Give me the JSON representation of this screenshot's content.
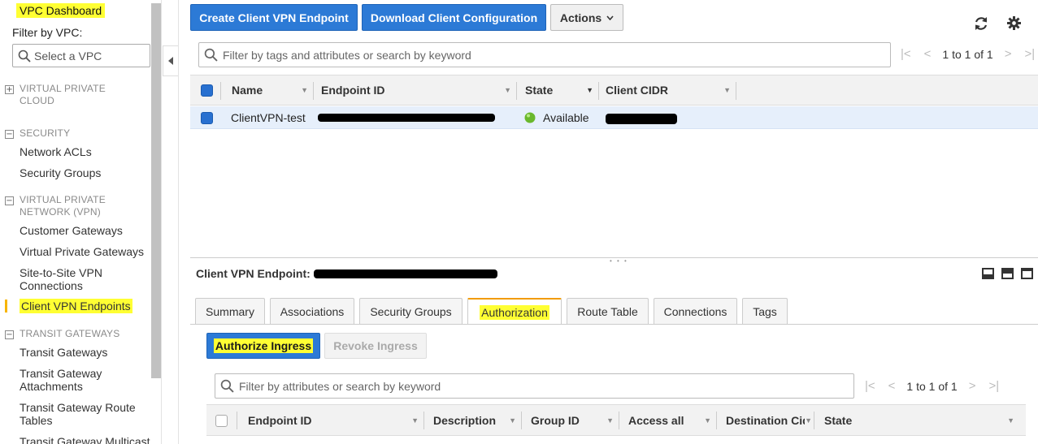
{
  "sidebar": {
    "dashboard": "VPC Dashboard",
    "filter_label": "Filter by VPC:",
    "vpc_placeholder": "Select a VPC",
    "groups": [
      {
        "toggle": "+",
        "title": "VIRTUAL PRIVATE CLOUD"
      },
      {
        "toggle": "−",
        "title": "SECURITY"
      },
      {
        "toggle": "−",
        "title": "VIRTUAL PRIVATE NETWORK (VPN)"
      },
      {
        "toggle": "−",
        "title": "TRANSIT GATEWAYS"
      }
    ],
    "items": {
      "network_acls": "Network ACLs",
      "security_groups": "Security Groups",
      "customer_gateways": "Customer Gateways",
      "virtual_private_gateways": "Virtual Private Gateways",
      "site_to_site_vpn": "Site-to-Site VPN Connections",
      "client_vpn_endpoints": "Client VPN Endpoints",
      "transit_gateways": "Transit Gateways",
      "tgw_attachments": "Transit Gateway Attachments",
      "tgw_route_tables": "Transit Gateway Route Tables",
      "tgw_multicast": "Transit Gateway Multicast"
    }
  },
  "toolbar": {
    "create_label": "Create Client VPN Endpoint",
    "download_label": "Download Client Configuration",
    "actions_label": "Actions"
  },
  "main_table": {
    "filter_placeholder": "Filter by tags and attributes or search by keyword",
    "pager_text": "1 to 1 of 1",
    "columns": [
      "Name",
      "Endpoint ID",
      "State",
      "Client CIDR"
    ],
    "rows": [
      {
        "name": "ClientVPN-test",
        "state": "Available"
      }
    ]
  },
  "details": {
    "title": "Client VPN Endpoint:",
    "tabs": [
      "Summary",
      "Associations",
      "Security Groups",
      "Authorization",
      "Route Table",
      "Connections",
      "Tags"
    ],
    "active_tab": "Authorization",
    "authorize_label": "Authorize Ingress",
    "revoke_label": "Revoke Ingress",
    "filter_placeholder": "Filter by attributes or search by keyword",
    "pager_text": "1 to 1 of 1",
    "columns": [
      "Endpoint ID",
      "Description",
      "Group ID",
      "Access all",
      "Destination Cid",
      "State"
    ]
  },
  "colors": {
    "primary": "#2c7ad6",
    "highlight": "#ffff33",
    "active_tab_accent": "#f29b00",
    "status_available": "#6ab82c"
  }
}
